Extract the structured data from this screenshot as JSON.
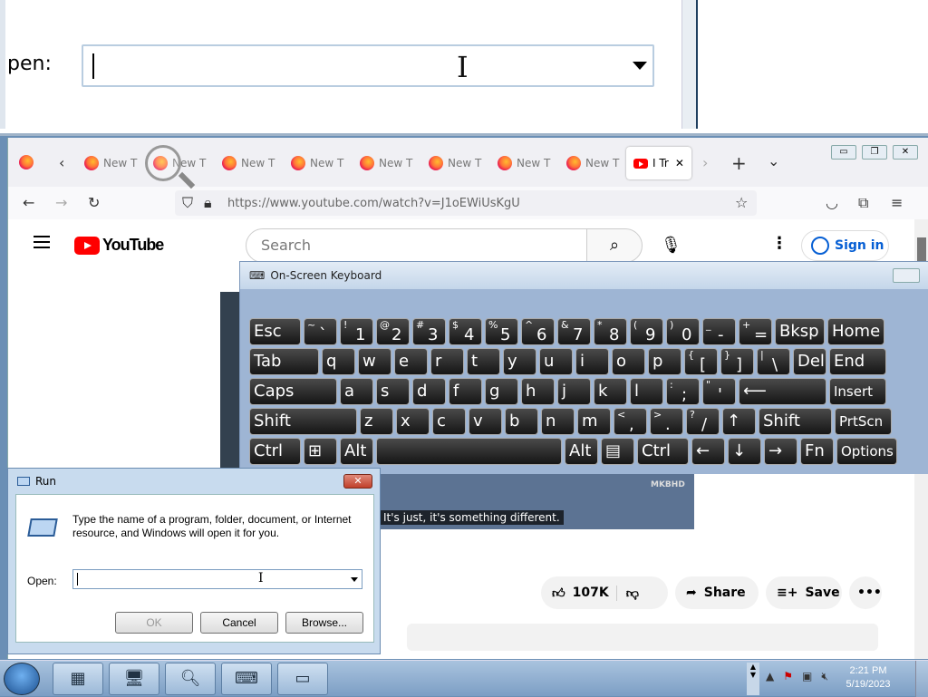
{
  "magnifier": {
    "open_label": "pen:"
  },
  "browser": {
    "tabs": [
      {
        "label": "New T"
      },
      {
        "label": "New T"
      },
      {
        "label": "New T"
      },
      {
        "label": "New T"
      },
      {
        "label": "New T"
      },
      {
        "label": "New T"
      },
      {
        "label": "New T"
      },
      {
        "label": "New T"
      }
    ],
    "active_tab": {
      "label": "I Tr"
    },
    "url": "https://www.youtube.com/watch?v=J1oEWiUsKgU"
  },
  "youtube": {
    "logo": "YouTube",
    "search_placeholder": "Search",
    "signin": "Sign in",
    "caption": "It's just, it's something different.",
    "watermark": "MKBHD",
    "likes": "107K",
    "share": "Share",
    "save": "Save"
  },
  "osk": {
    "title": "On-Screen Keyboard",
    "rows": [
      [
        "Esc",
        "~ `",
        "! 1",
        "@ 2",
        "# 3",
        "$ 4",
        "% 5",
        "^ 6",
        "& 7",
        "* 8",
        "( 9",
        ") 0",
        "_ -",
        "+ =",
        "Bksp",
        "Home"
      ],
      [
        "Tab",
        "q",
        "w",
        "e",
        "r",
        "t",
        "y",
        "u",
        "i",
        "o",
        "p",
        "{ [",
        "} ]",
        "| \\",
        "Del",
        "End"
      ],
      [
        "Caps",
        "a",
        "s",
        "d",
        "f",
        "g",
        "h",
        "j",
        "k",
        "l",
        ": ;",
        "\" '",
        "⟵",
        "Insert"
      ],
      [
        "Shift",
        "z",
        "x",
        "c",
        "v",
        "b",
        "n",
        "m",
        "< ,",
        "> .",
        "? /",
        "↑",
        "Shift",
        "PrtScn"
      ],
      [
        "Ctrl",
        "⊞",
        "Alt",
        "",
        "Alt",
        "▤",
        "Ctrl",
        "←",
        "↓",
        "→",
        "Fn",
        "Options"
      ]
    ]
  },
  "run": {
    "title": "Run",
    "description": "Type the name of a program, folder, document, or Internet resource, and Windows will open it for you.",
    "open_label": "Open:",
    "open_value": "",
    "ok": "OK",
    "cancel": "Cancel",
    "browse": "Browse..."
  },
  "taskbar": {
    "time": "2:21 PM",
    "date": "5/19/2023"
  }
}
